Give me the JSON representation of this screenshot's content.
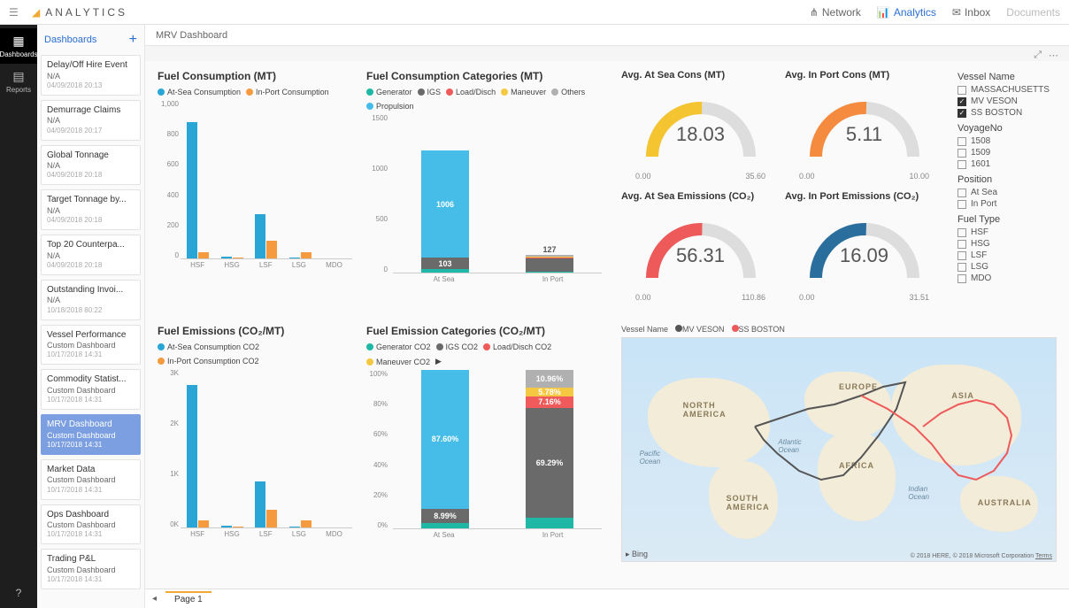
{
  "brand": "ANALYTICS",
  "topnav": [
    {
      "label": "Network",
      "active": false
    },
    {
      "label": "Analytics",
      "active": true
    },
    {
      "label": "Inbox",
      "active": false
    },
    {
      "label": "Documents",
      "active": false,
      "disabled": true
    }
  ],
  "rail": [
    {
      "label": "Dashboards",
      "active": true
    },
    {
      "label": "Reports",
      "active": false
    }
  ],
  "sidebar": {
    "title": "Dashboards",
    "items": [
      {
        "t": "Delay/Off Hire Event",
        "s": "N/A",
        "d": "04/09/2018 20:13"
      },
      {
        "t": "Demurrage Claims",
        "s": "N/A",
        "d": "04/09/2018 20:17"
      },
      {
        "t": "Global Tonnage",
        "s": "N/A",
        "d": "04/09/2018 20:18"
      },
      {
        "t": "Target Tonnage by...",
        "s": "N/A",
        "d": "04/09/2018 20:18"
      },
      {
        "t": "Top 20 Counterpa...",
        "s": "N/A",
        "d": "04/09/2018 20:18"
      },
      {
        "t": "Outstanding Invoi...",
        "s": "N/A",
        "d": "10/18/2018 80:22"
      },
      {
        "t": "Vessel Performance",
        "s": "Custom Dashboard",
        "d": "10/17/2018 14:31"
      },
      {
        "t": "Commodity Statist...",
        "s": "Custom Dashboard",
        "d": "10/17/2018 14:31"
      },
      {
        "t": "MRV Dashboard",
        "s": "Custom Dashboard",
        "d": "10/17/2018 14:31",
        "active": true
      },
      {
        "t": "Market Data",
        "s": "Custom Dashboard",
        "d": "10/17/2018 14:31"
      },
      {
        "t": "Ops Dashboard",
        "s": "Custom Dashboard",
        "d": "10/17/2018 14:31"
      },
      {
        "t": "Trading P&L",
        "s": "Custom Dashboard",
        "d": "10/17/2018 14:31"
      }
    ]
  },
  "breadcrumb": "MRV Dashboard",
  "page_tab": "Page 1",
  "chart_data": [
    {
      "id": "fuel_consumption",
      "type": "bar",
      "title": "Fuel Consumption (MT)",
      "series_names": [
        "At-Sea Consumption",
        "In-Port Consumption"
      ],
      "categories": [
        "HSF",
        "HSG",
        "LSF",
        "LSG",
        "MDO"
      ],
      "series": [
        {
          "name": "At-Sea Consumption",
          "values": [
            860,
            10,
            280,
            5,
            0
          ]
        },
        {
          "name": "In-Port Consumption",
          "values": [
            40,
            5,
            110,
            40,
            0
          ]
        }
      ],
      "ylim": [
        0,
        1000
      ],
      "yticks": [
        0,
        200,
        400,
        600,
        800,
        1000
      ]
    },
    {
      "id": "fuel_consumption_cat",
      "type": "stacked-bar",
      "title": "Fuel Consumption Categories (MT)",
      "series_names": [
        "Generator",
        "IGS",
        "Load/Disch",
        "Maneuver",
        "Others",
        "Propulsion"
      ],
      "categories": [
        "At Sea",
        "In Port"
      ],
      "stacks": {
        "At Sea": {
          "Generator": 40,
          "IGS": 103,
          "Propulsion": 1006
        },
        "In Port": {
          "Generator": 10,
          "IGS": 127,
          "Load/Disch": 10,
          "Maneuver": 10
        }
      },
      "labels": {
        "At Sea": [
          {
            "v": "1006"
          },
          {
            "v": "103"
          }
        ],
        "In Port": [
          {
            "v": "127"
          }
        ]
      },
      "ylim": [
        0,
        1500
      ],
      "yticks": [
        0,
        500,
        1000,
        1500
      ]
    },
    {
      "id": "gauge_sea_cons",
      "type": "gauge",
      "title": "Avg. At Sea Cons (MT)",
      "value": 18.03,
      "min": 0,
      "max": 35.6,
      "color": "#f5c531"
    },
    {
      "id": "gauge_port_cons",
      "type": "gauge",
      "title": "Avg. In Port Cons (MT)",
      "value": 5.11,
      "min": 0,
      "max": 10,
      "color": "#f58b3e"
    },
    {
      "id": "gauge_sea_emis",
      "type": "gauge",
      "title": "Avg. At Sea Emissions (CO₂)",
      "value": 56.31,
      "min": 0,
      "max": 110.86,
      "color": "#ee5a5a"
    },
    {
      "id": "gauge_port_emis",
      "type": "gauge",
      "title": "Avg. In Port Emissions (CO₂)",
      "value": 16.09,
      "min": 0,
      "max": 31.51,
      "color": "#2a6e9e"
    },
    {
      "id": "fuel_emissions",
      "type": "bar",
      "title": "Fuel Emissions (CO₂/MT)",
      "series_names": [
        "At-Sea Consumption CO2",
        "In-Port Consumption CO2"
      ],
      "categories": [
        "HSF",
        "HSG",
        "LSF",
        "LSG",
        "MDO"
      ],
      "series": [
        {
          "name": "At-Sea Consumption CO2",
          "values": [
            2700,
            30,
            880,
            20,
            0
          ]
        },
        {
          "name": "In-Port Consumption CO2",
          "values": [
            130,
            20,
            340,
            130,
            0
          ]
        }
      ],
      "ylim": [
        0,
        3000
      ],
      "yticks": [
        "0K",
        "1K",
        "2K",
        "3K"
      ]
    },
    {
      "id": "fuel_emission_cat",
      "type": "stacked-bar-pct",
      "title": "Fuel Emission Categories (CO₂/MT)",
      "series_names": [
        "Generator CO2",
        "IGS CO2",
        "Load/Disch CO2",
        "Maneuver CO2"
      ],
      "categories": [
        "At Sea",
        "In Port"
      ],
      "stacks_pct": {
        "At Sea": {
          "Generator CO2": 3.41,
          "IGS CO2": 8.99,
          "Propulsion CO2": 87.6
        },
        "In Port": {
          "Generator CO2": 6.81,
          "IGS CO2": 69.29,
          "Load/Disch CO2": 7.16,
          "Maneuver CO2": 5.78,
          "Others CO2": 10.96
        }
      },
      "labels": {
        "At Sea": [
          "87.60%",
          "8.99%"
        ],
        "In Port": [
          "69.29%",
          "5.78%",
          "7.16%",
          "10.96%"
        ]
      },
      "yticks": [
        "0%",
        "20%",
        "40%",
        "60%",
        "80%",
        "100%"
      ]
    }
  ],
  "map": {
    "legend_label": "Vessel Name",
    "series": [
      {
        "name": "MV VESON",
        "color": "#555"
      },
      {
        "name": "SS BOSTON",
        "color": "#ee5a5a"
      }
    ],
    "attribution": "© 2018 HERE, © 2018 Microsoft Corporation",
    "terms": "Terms",
    "provider": "Bing"
  },
  "filters": {
    "vessel_name": {
      "label": "Vessel Name",
      "options": [
        {
          "label": "MASSACHUSETTS",
          "checked": false
        },
        {
          "label": "MV VESON",
          "checked": true
        },
        {
          "label": "SS BOSTON",
          "checked": true
        }
      ]
    },
    "voyage": {
      "label": "VoyageNo",
      "options": [
        {
          "label": "1508",
          "checked": false
        },
        {
          "label": "1509",
          "checked": false
        },
        {
          "label": "1601",
          "checked": false
        }
      ]
    },
    "position": {
      "label": "Position",
      "options": [
        {
          "label": "At Sea",
          "checked": false
        },
        {
          "label": "In Port",
          "checked": false
        }
      ]
    },
    "fuel_type": {
      "label": "Fuel Type",
      "options": [
        {
          "label": "HSF",
          "checked": false
        },
        {
          "label": "HSG",
          "checked": false
        },
        {
          "label": "LSF",
          "checked": false
        },
        {
          "label": "LSG",
          "checked": false
        },
        {
          "label": "MDO",
          "checked": false
        }
      ]
    }
  },
  "colors": {
    "teal": "#1fb8a6",
    "grey": "#6a6a6a",
    "red": "#f15a5a",
    "yellow": "#f5c842",
    "lgrey": "#b0b0b0",
    "sky": "#46bde8",
    "blue": "#2aa6d6",
    "orange": "#f59a3e"
  }
}
